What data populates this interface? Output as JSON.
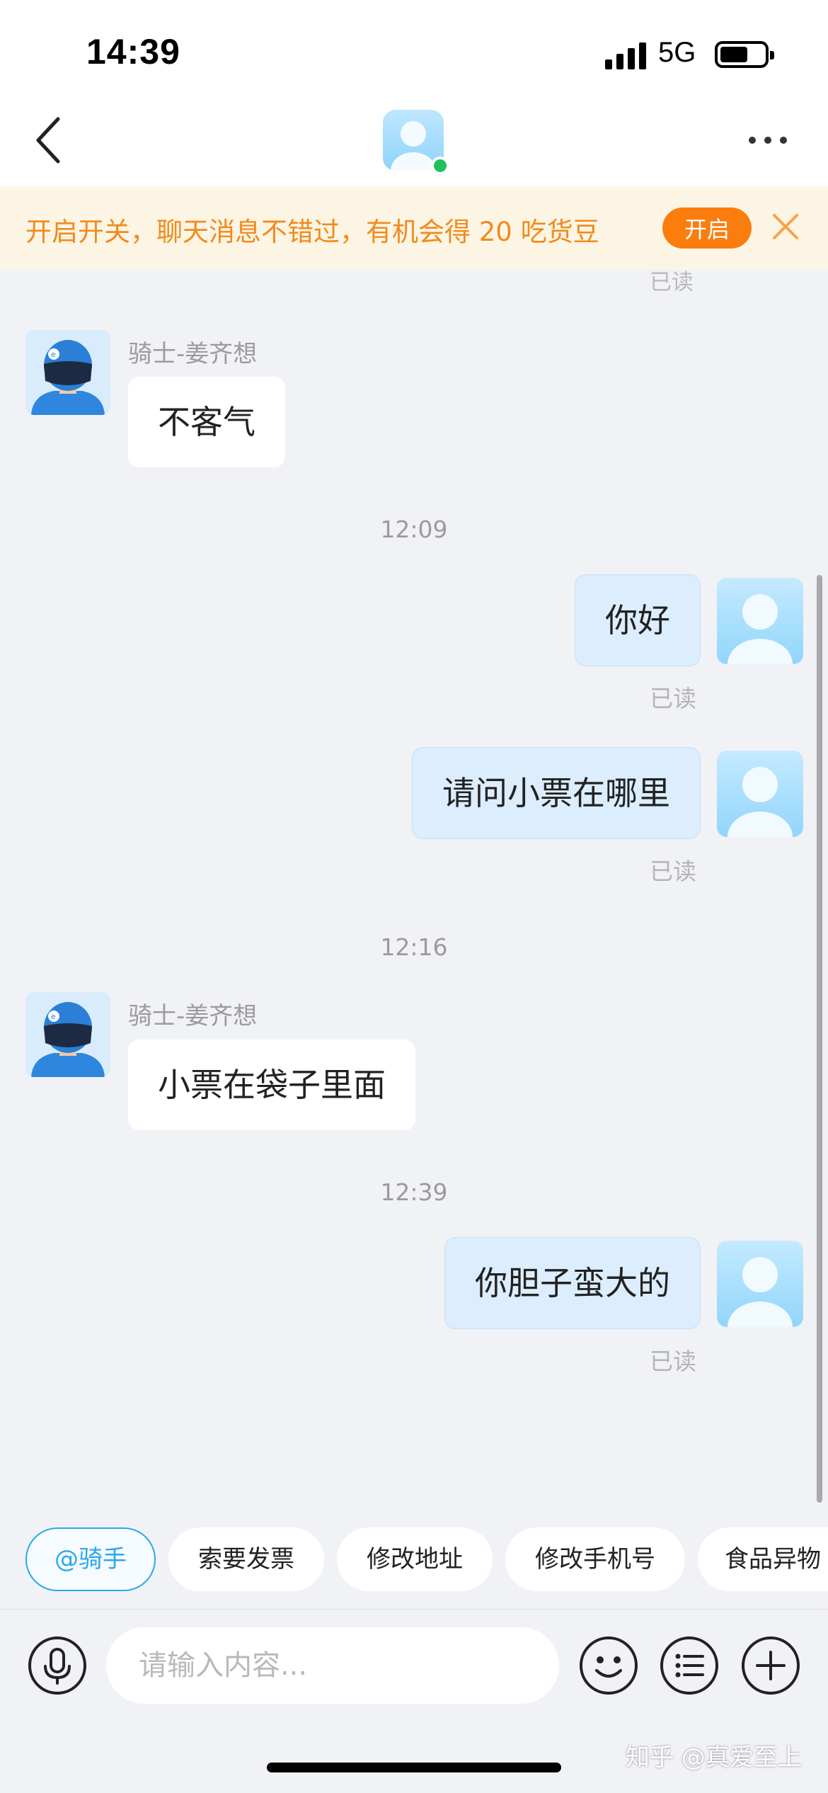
{
  "status_bar": {
    "time": "14:39",
    "network": "5G"
  },
  "notice": {
    "text": "开启开关，聊天消息不错过，有机会得 20 吃货豆",
    "button_label": "开启"
  },
  "messages": {
    "read_label": "已读",
    "m1": {
      "sender": "骑士-姜齐想",
      "text": "不客气"
    },
    "t1": "12:09",
    "m2": {
      "text": "你好"
    },
    "m3": {
      "text": "请问小票在哪里"
    },
    "t2": "12:16",
    "m4": {
      "sender": "骑士-姜齐想",
      "text": "小票在袋子里面"
    },
    "t3": "12:39",
    "m5": {
      "text": "你胆子蛮大的"
    }
  },
  "quick_replies": [
    "@骑手",
    "索要发票",
    "修改地址",
    "修改手机号",
    "食品异物"
  ],
  "input": {
    "placeholder": "请输入内容..."
  },
  "watermark": "知乎 @真爱至上",
  "colors": {
    "accent_orange": "#fb7d0e",
    "notice_text": "#f28a1c",
    "outgoing_bubble": "#dcedfd",
    "chip_active": "#2aa8ec",
    "online": "#22c05a"
  }
}
